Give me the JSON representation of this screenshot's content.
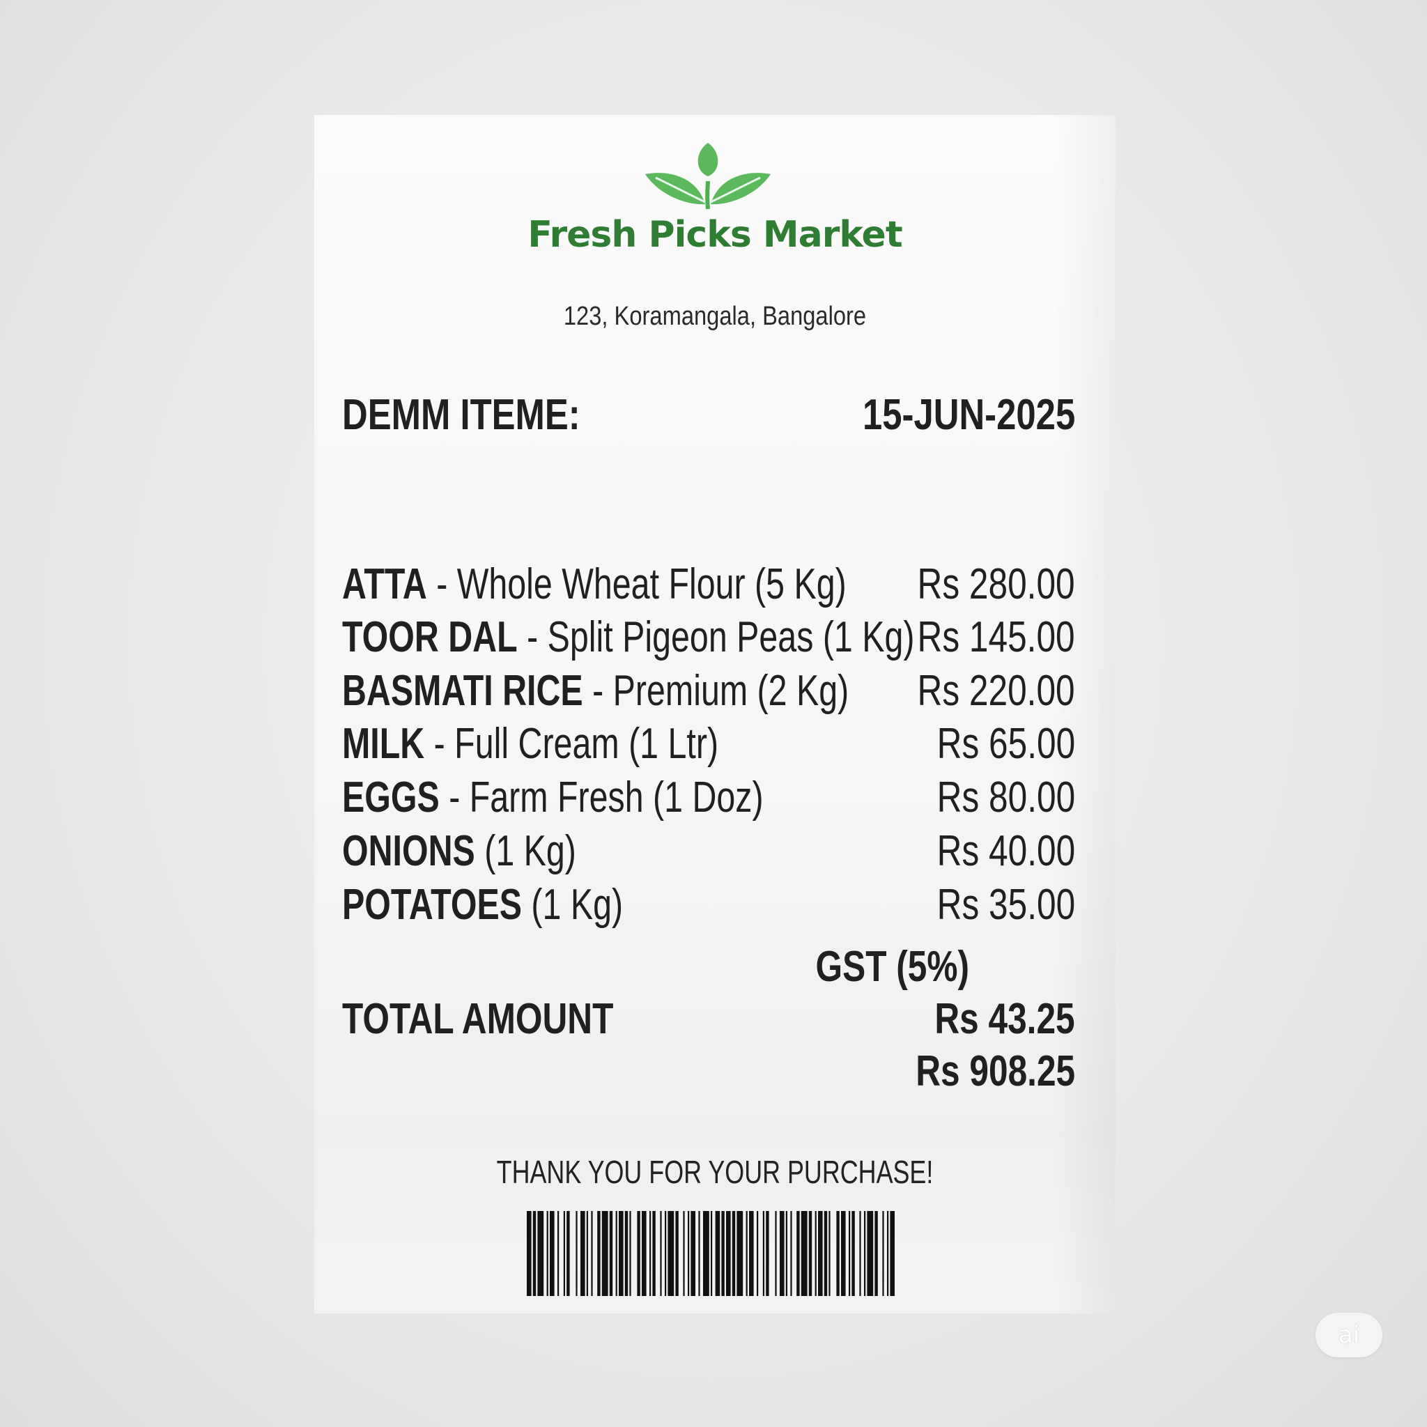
{
  "store": {
    "name": "Fresh Picks Market",
    "address": "123, Koramangala, Bangalore",
    "logo_icon": "leaf-sprout-icon",
    "brand_color": "#2e7d32",
    "leaf_color": "#5cb85c"
  },
  "header": {
    "label": "DEMM ITEME:",
    "date": "15-JUN-2025"
  },
  "items": [
    {
      "name": "ATTA",
      "desc": " - Whole Wheat Flour (5 Kg)",
      "price": "Rs 280.00"
    },
    {
      "name": "TOOR DAL",
      "desc": " - Split Pigeon Peas (1 Kg)",
      "price": "Rs 145.00"
    },
    {
      "name": "BASMATI RICE",
      "desc": " - Premium (2 Kg)",
      "price": "Rs 220.00"
    },
    {
      "name": "MILK",
      "desc": " - Full Cream (1 Ltr)",
      "price": "Rs 65.00"
    },
    {
      "name": "EGGS",
      "desc": " - Farm Fresh (1 Doz)",
      "price": "Rs 80.00"
    },
    {
      "name": "ONIONS",
      "desc": " (1 Kg)",
      "price": "Rs 40.00"
    },
    {
      "name": "POTATOES",
      "desc": " (1 Kg)",
      "price": "Rs 35.00"
    }
  ],
  "summary": {
    "gst_label": "GST (5%)",
    "total_label": "TOTAL AMOUNT",
    "gst_amount": "Rs 43.25",
    "total_amount": "Rs 908.25"
  },
  "footer": {
    "thanks": "THANK YOU FOR YOUR PURCHASE!",
    "barcode_icon": "barcode-icon"
  },
  "badge": {
    "label": "ai"
  }
}
